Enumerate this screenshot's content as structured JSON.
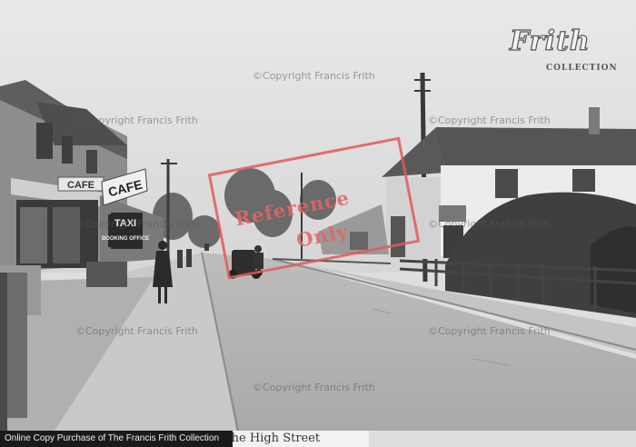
{
  "photo": {
    "caption": "The High Street",
    "copyright_bar": "Online Copy Purchase of The Francis Frith Collection",
    "watermark_text": "©Copyright Francis Frith",
    "logo": {
      "line1": "Frith",
      "line2": "COLLECTION"
    },
    "stamp": {
      "line1": "Reference",
      "line2": "Only"
    },
    "shop_signs": {
      "cafe_top": "CAFE",
      "cafe_banner": "CAFE",
      "taxi": "TAXI",
      "booking_office": "BOOKING OFFICE"
    }
  }
}
